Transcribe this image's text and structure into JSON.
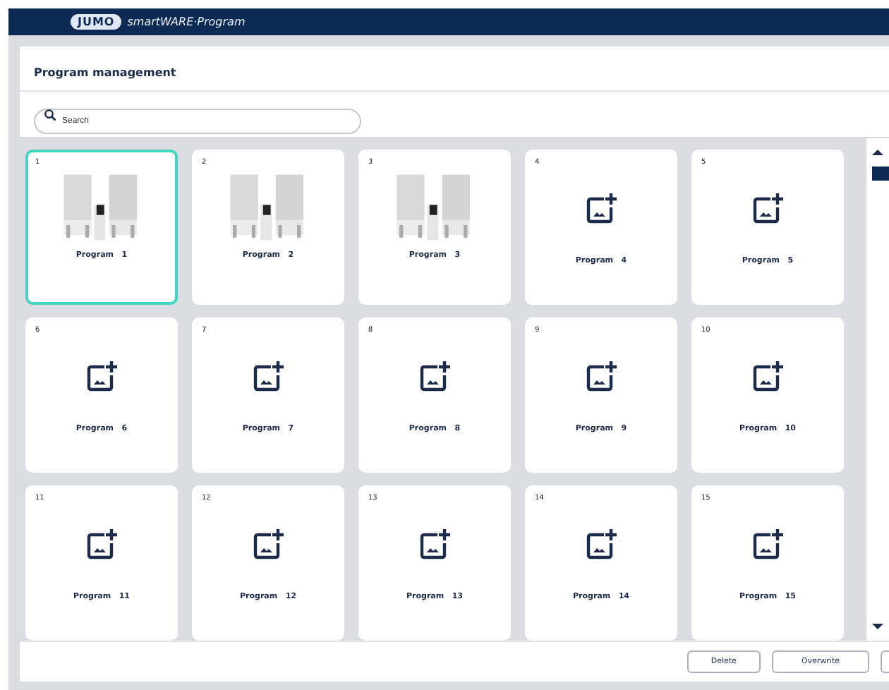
{
  "window": {
    "app_name": "smartWARE·Program",
    "logo_text": "JUMO"
  },
  "page_title": "Program management",
  "search": {
    "placeholder": "Search"
  },
  "programs": [
    {
      "number": "1",
      "name": "Program   1",
      "kind": "photo",
      "selected": true
    },
    {
      "number": "2",
      "name": "Program   2",
      "kind": "photo",
      "selected": false
    },
    {
      "number": "3",
      "name": "Program   3",
      "kind": "photo",
      "selected": false
    },
    {
      "number": "4",
      "name": "Program   4",
      "kind": "empty",
      "selected": false
    },
    {
      "number": "5",
      "name": "Program   5",
      "kind": "empty",
      "selected": false
    },
    {
      "number": "6",
      "name": "Program   6",
      "kind": "empty",
      "selected": false
    },
    {
      "number": "7",
      "name": "Program   7",
      "kind": "empty",
      "selected": false
    },
    {
      "number": "8",
      "name": "Program   8",
      "kind": "empty",
      "selected": false
    },
    {
      "number": "9",
      "name": "Program   9",
      "kind": "empty",
      "selected": false
    },
    {
      "number": "10",
      "name": "Program   10",
      "kind": "empty",
      "selected": false
    },
    {
      "number": "11",
      "name": "Program   11",
      "kind": "empty",
      "selected": false
    },
    {
      "number": "12",
      "name": "Program   12",
      "kind": "empty",
      "selected": false
    },
    {
      "number": "13",
      "name": "Program   13",
      "kind": "empty",
      "selected": false
    },
    {
      "number": "14",
      "name": "Program   14",
      "kind": "empty",
      "selected": false
    },
    {
      "number": "15",
      "name": "Program   15",
      "kind": "empty",
      "selected": false
    }
  ],
  "buttons": [
    "Delete",
    "Overwrite"
  ]
}
